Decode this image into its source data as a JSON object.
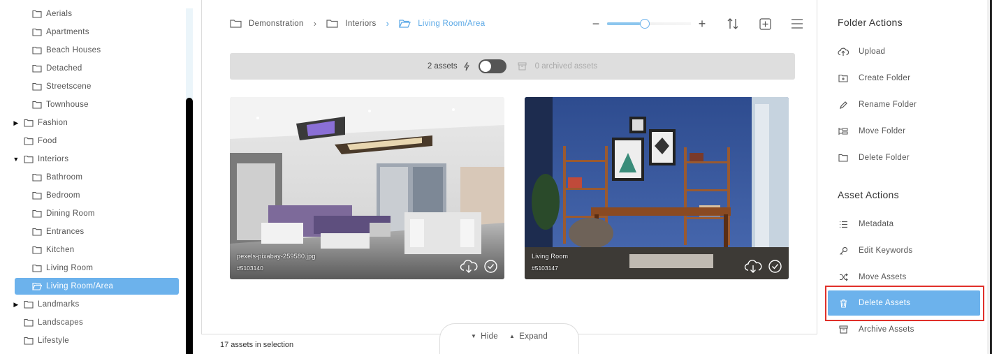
{
  "tree": {
    "items": [
      {
        "label": "Aerials",
        "indent": 2,
        "caret": ""
      },
      {
        "label": "Apartments",
        "indent": 2,
        "caret": ""
      },
      {
        "label": "Beach Houses",
        "indent": 2,
        "caret": ""
      },
      {
        "label": "Detached",
        "indent": 2,
        "caret": ""
      },
      {
        "label": "Streetscene",
        "indent": 2,
        "caret": ""
      },
      {
        "label": "Townhouse",
        "indent": 2,
        "caret": ""
      },
      {
        "label": "Fashion",
        "indent": 1,
        "caret": "right"
      },
      {
        "label": "Food",
        "indent": 1,
        "caret": ""
      },
      {
        "label": "Interiors",
        "indent": 1,
        "caret": "down"
      },
      {
        "label": "Bathroom",
        "indent": 2,
        "caret": ""
      },
      {
        "label": "Bedroom",
        "indent": 2,
        "caret": ""
      },
      {
        "label": "Dining Room",
        "indent": 2,
        "caret": ""
      },
      {
        "label": "Entrances",
        "indent": 2,
        "caret": ""
      },
      {
        "label": "Kitchen",
        "indent": 2,
        "caret": ""
      },
      {
        "label": "Living Room",
        "indent": 2,
        "caret": ""
      },
      {
        "label": "Living Room/Area",
        "indent": 2,
        "caret": "",
        "selected": true
      },
      {
        "label": "Landmarks",
        "indent": 1,
        "caret": "right"
      },
      {
        "label": "Landscapes",
        "indent": 1,
        "caret": ""
      },
      {
        "label": "Lifestyle",
        "indent": 1,
        "caret": ""
      }
    ]
  },
  "breadcrumb": {
    "items": [
      "Demonstration",
      "Interiors",
      "Living Room/Area"
    ]
  },
  "toolbar": {
    "zoom_level": 0.4
  },
  "summary": {
    "asset_count": "2 assets",
    "archived_count": "0 archived assets"
  },
  "assets": [
    {
      "name": "pexels-pixabay-259580.jpg",
      "id": "#5103140"
    },
    {
      "name": "Living Room",
      "id": "#5103147"
    }
  ],
  "footer": {
    "hide_label": "Hide",
    "expand_label": "Expand",
    "selection_count": "17 assets in selection"
  },
  "actions": {
    "folder_title": "Folder Actions",
    "folder_items": [
      "Upload",
      "Create Folder",
      "Rename Folder",
      "Move Folder",
      "Delete Folder"
    ],
    "asset_title": "Asset Actions",
    "asset_items": [
      "Metadata",
      "Edit Keywords",
      "Move Assets",
      "Delete Assets",
      "Archive Assets"
    ]
  },
  "colors": {
    "accent": "#6cb2ec",
    "highlight_outline": "#e0302a"
  }
}
